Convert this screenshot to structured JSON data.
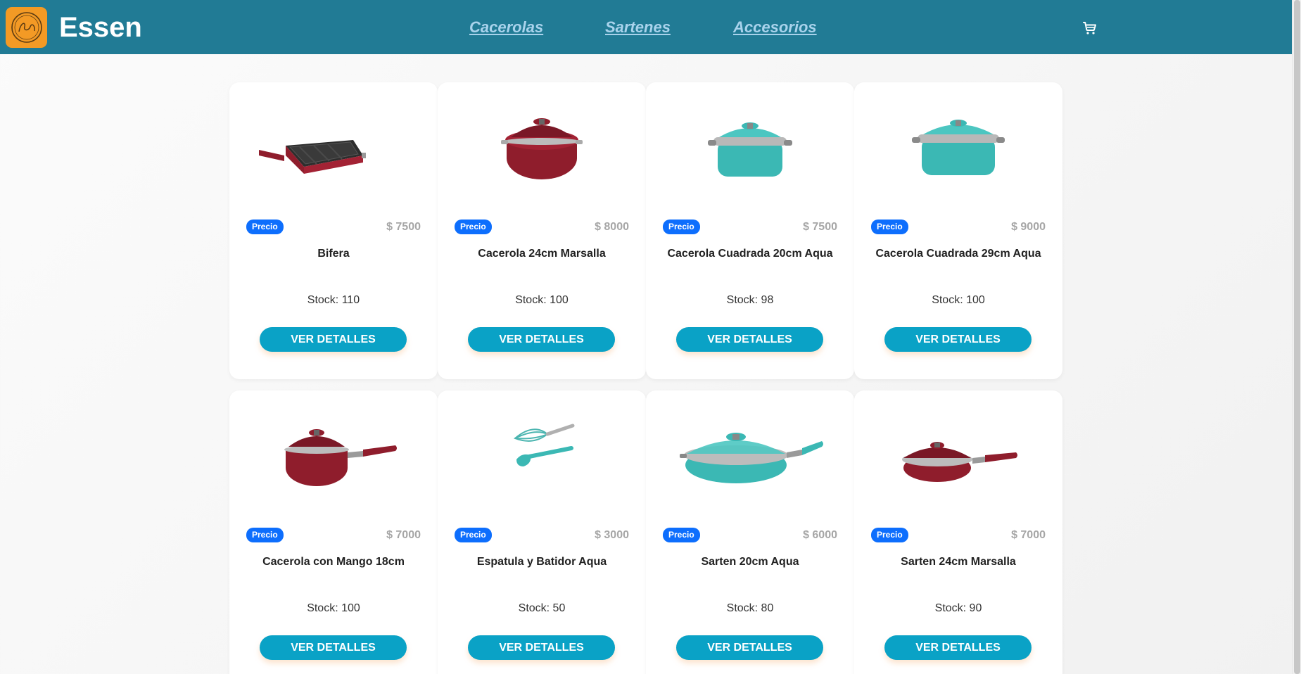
{
  "header": {
    "brand": "Essen",
    "nav": [
      "Cacerolas",
      "Sartenes",
      "Accesorios"
    ],
    "cart_icon": "cart-icon"
  },
  "products": [
    {
      "name": "Bifera",
      "badge": "Precio",
      "price": "$ 7500",
      "stock": "Stock: 110",
      "button": "VER DETALLES",
      "image": "grill-pan-marsalla"
    },
    {
      "name": "Cacerola 24cm Marsalla",
      "badge": "Precio",
      "price": "$ 8000",
      "stock": "Stock: 100",
      "button": "VER DETALLES",
      "image": "casserole-marsalla"
    },
    {
      "name": "Cacerola Cuadrada 20cm Aqua",
      "badge": "Precio",
      "price": "$ 7500",
      "stock": "Stock: 98",
      "button": "VER DETALLES",
      "image": "square-casserole-aqua"
    },
    {
      "name": "Cacerola Cuadrada 29cm Aqua",
      "badge": "Precio",
      "price": "$ 9000",
      "stock": "Stock: 100",
      "button": "VER DETALLES",
      "image": "square-casserole-aqua-large"
    },
    {
      "name": "Cacerola con Mango 18cm",
      "badge": "Precio",
      "price": "$ 7000",
      "stock": "Stock: 100",
      "button": "VER DETALLES",
      "image": "saucepan-marsalla"
    },
    {
      "name": "Espatula y Batidor Aqua",
      "badge": "Precio",
      "price": "$ 3000",
      "stock": "Stock: 50",
      "button": "VER DETALLES",
      "image": "spatula-whisk-aqua"
    },
    {
      "name": "Sarten 20cm Aqua",
      "badge": "Precio",
      "price": "$ 6000",
      "stock": "Stock: 80",
      "button": "VER DETALLES",
      "image": "frying-pan-aqua"
    },
    {
      "name": "Sarten 24cm Marsalla",
      "badge": "Precio",
      "price": "$ 7000",
      "stock": "Stock: 90",
      "button": "VER DETALLES",
      "image": "frying-pan-marsalla"
    }
  ],
  "colors": {
    "navbar": "#217b95",
    "logo": "#f39a25",
    "nav_link": "#a9d3ec",
    "badge": "#0d6efd",
    "button": "#0aa2c6",
    "marsalla": "#8f1d2c",
    "aqua": "#3bb8b4"
  }
}
